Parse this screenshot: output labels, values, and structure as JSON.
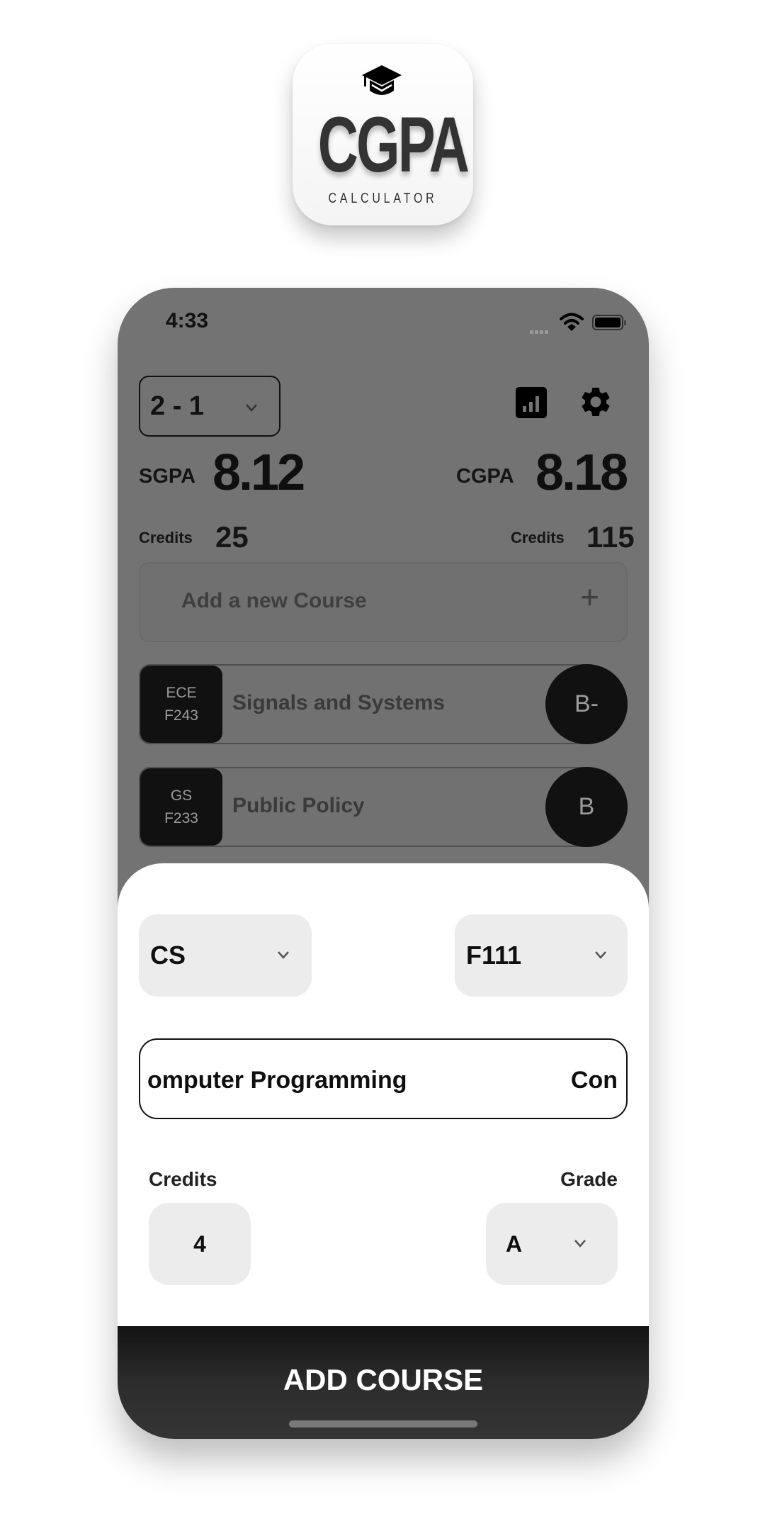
{
  "app_icon": {
    "icon": "graduation-cap-icon",
    "title": "CGPA",
    "subtitle": "CALCULATOR"
  },
  "status_bar": {
    "time": "4:33",
    "icons": [
      "signal-dots-icon",
      "wifi-icon",
      "battery-icon"
    ]
  },
  "header": {
    "semester": "2 - 1",
    "stats_icon": "bar-chart-icon",
    "settings_icon": "gear-icon"
  },
  "summary": {
    "sgpa_label": "SGPA",
    "sgpa_value": "8.12",
    "cgpa_label": "CGPA",
    "cgpa_value": "8.18",
    "sem_credits_label": "Credits",
    "sem_credits_value": "25",
    "total_credits_label": "Credits",
    "total_credits_value": "115"
  },
  "add_course_row": {
    "label": "Add a new Course",
    "icon": "plus-icon"
  },
  "courses": [
    {
      "dept": "ECE",
      "number": "F243",
      "name": "Signals and Systems",
      "grade": "B-"
    },
    {
      "dept": "GS",
      "number": "F233",
      "name": "Public Policy",
      "grade": "B"
    }
  ],
  "sheet": {
    "dept_select": "CS",
    "number_select": "F111",
    "course_name_visible": "omputer Programming",
    "course_name_repeat": "Con",
    "credits_label": "Credits",
    "credits_value": "4",
    "grade_label": "Grade",
    "grade_value": "A",
    "submit_label": "ADD COURSE"
  },
  "colors": {
    "overlay": "#737373",
    "dark": "#111111",
    "sheet": "#ffffff",
    "field_bg": "#ececec",
    "button": "#2c2c2c"
  }
}
